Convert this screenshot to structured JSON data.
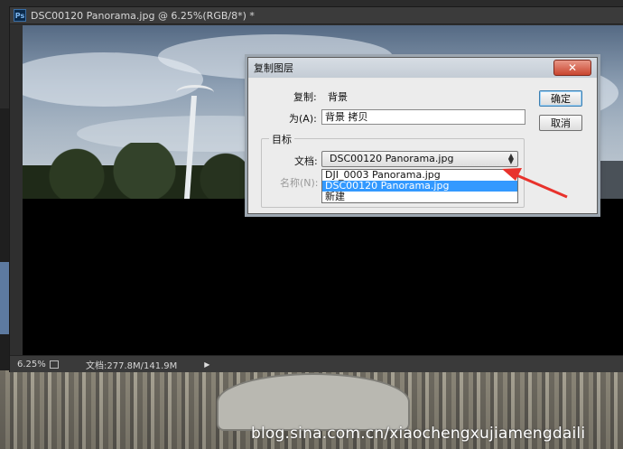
{
  "document": {
    "title": "DSC00120 Panorama.jpg @ 6.25%(RGB/8*) *",
    "app_badge": "Ps"
  },
  "statusbar": {
    "zoom": "6.25%",
    "doc_info": "文档:277.8M/141.9M",
    "menu_glyph": "▶"
  },
  "dialog": {
    "title": "复制图层",
    "close_glyph": "✕",
    "copy_label": "复制:",
    "copy_value": "背景",
    "as_label": "为(A):",
    "as_value": "背景 拷贝",
    "ok_label": "确定",
    "cancel_label": "取消",
    "target_group": "目标",
    "doc_label": "文档:",
    "doc_selected": "DSC00120 Panorama.jpg",
    "name_label": "名称(N):",
    "doc_options": [
      "DJI_0003 Panorama.jpg",
      "DSC00120 Panorama.jpg",
      "新建"
    ]
  },
  "watermark": "blog.sina.com.cn/xiaochengxujiamengdaili",
  "colors": {
    "selection": "#3399ff",
    "annotation_arrow": "#e8322c",
    "close_button": "#c9452f"
  },
  "icons": [
    "photoshop-icon",
    "close-icon",
    "export-icon",
    "play-icon",
    "spinner-icon",
    "annotation-arrow"
  ]
}
